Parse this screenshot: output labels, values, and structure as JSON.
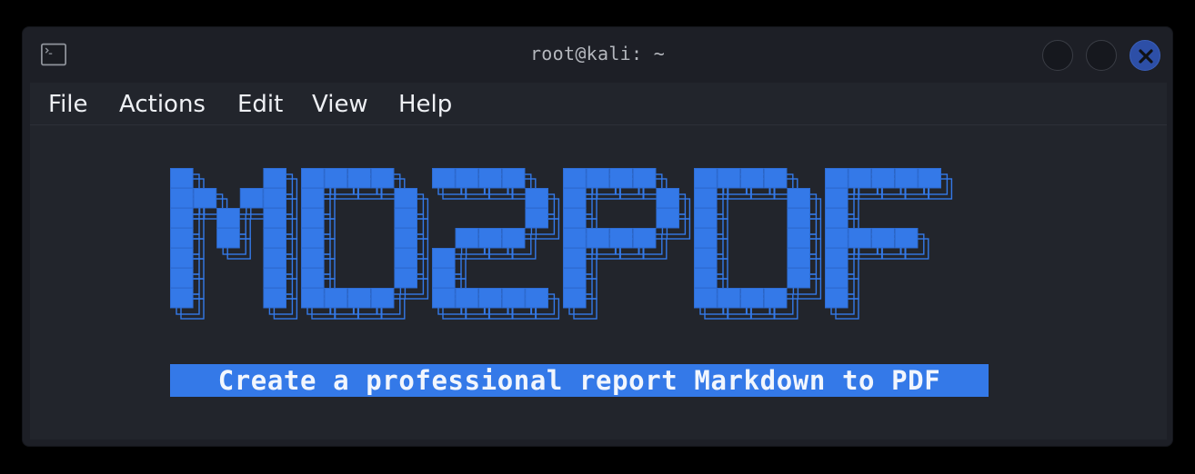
{
  "window": {
    "title": "root@kali: ~",
    "terminal_icon": "terminal-icon",
    "controls": [
      "minimize-button",
      "maximize-button",
      "close-button"
    ]
  },
  "menu": {
    "items": [
      "File",
      "Actions",
      "Edit",
      "View",
      "Help"
    ]
  },
  "banner": {
    "ascii_title": "MD2PDF",
    "tagline": "Create a professional report Markdown to PDF",
    "colors": {
      "block": "#3479e8",
      "outline": "#3479e8",
      "background": "#22252c"
    }
  }
}
